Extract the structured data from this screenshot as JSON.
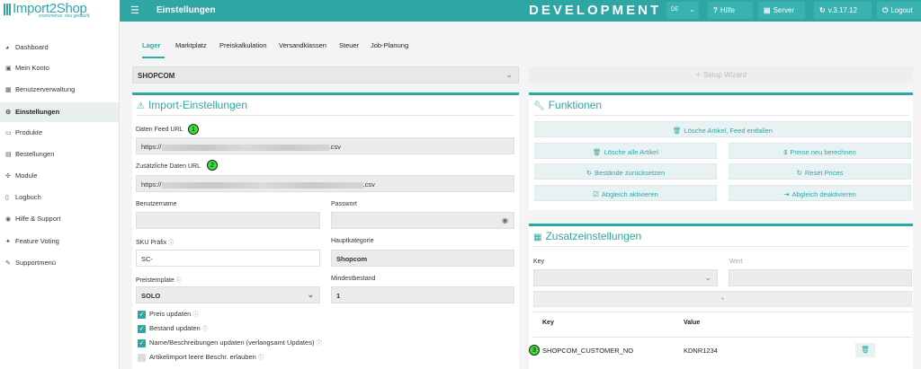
{
  "app": {
    "logo_text": "Import2Shop",
    "logo_tagline": "ecommerce. neu gedacht.",
    "page_title": "Einstellungen",
    "environment": "DEVELOPMENT",
    "language": "DE",
    "help_label": "Hilfe",
    "server_label": "Server",
    "version_label": "v.3.17.12",
    "logout_label": "Logout",
    "accent_color": "#2ea7a4"
  },
  "sidebar": {
    "items": [
      {
        "label": "Dashboard",
        "icon": "dashboard-icon"
      },
      {
        "label": "Mein Konto",
        "icon": "user-icon"
      },
      {
        "label": "Benutzerverwaltung",
        "icon": "users-icon"
      },
      {
        "label": "Einstellungen",
        "icon": "gear-icon",
        "active": true
      },
      {
        "label": "Produkte",
        "icon": "product-icon"
      },
      {
        "label": "Bestellungen",
        "icon": "cart-icon"
      },
      {
        "label": "Module",
        "icon": "module-icon"
      },
      {
        "label": "Logbuch",
        "icon": "log-icon"
      },
      {
        "label": "Hilfe & Support",
        "icon": "help-icon"
      },
      {
        "label": "Feature Voting",
        "icon": "thumbs-up-icon"
      },
      {
        "label": "Supportmenü",
        "icon": "wrench-icon"
      }
    ]
  },
  "tabs": [
    "Lager",
    "Marktplatz",
    "Preiskalkulation",
    "Versandklassen",
    "Steuer",
    "Job-Planung"
  ],
  "shop_select": {
    "value": "SHOPCOM"
  },
  "setup_wizard_label": "Setup Wizard",
  "import": {
    "title": "Import-Einstellungen",
    "feed_url_label": "Daten Feed URL",
    "feed_url_prefix": "https://",
    "feed_url_suffix": ".csv",
    "extra_url_label": "Zusätzliche Daten URL",
    "extra_url_prefix": "https://",
    "extra_url_suffix": ".csv",
    "username_label": "Benutzername",
    "username_value": "",
    "password_label": "Passwort",
    "password_value": "",
    "sku_label": "SKU Präfix",
    "sku_value": "SC-",
    "category_label": "Hauptkategorie",
    "category_value": "Shopcom",
    "price_template_label": "Preistemplate",
    "price_template_value": "SOLO",
    "min_stock_label": "Mindestbestand",
    "min_stock_value": "1",
    "checkboxes": [
      {
        "label": "Preis updaten",
        "checked": true
      },
      {
        "label": "Bestand updaten",
        "checked": true
      },
      {
        "label": "Name/Beschreibungen updaten (verlangsamt Updates)",
        "checked": true
      },
      {
        "label": "Artikelimport leere Beschr. erlauben",
        "checked": false
      }
    ]
  },
  "markers": [
    "1",
    "2",
    "3"
  ],
  "functions": {
    "title": "Funktionen",
    "delete_feed_label": "Lösche Artikel, Feed entfallen",
    "delete_all_label": "Lösche alle Artikel",
    "recalc_prices_label": "Preise neu berechnen",
    "reset_stock_label": "Bestände zurücksetzen",
    "reset_prices_label": "Reset Prices",
    "activate_sync_label": "Abgleich aktivieren",
    "deactivate_sync_label": "Abgleich deaktivieren"
  },
  "extra": {
    "title": "Zusatzeinstellungen",
    "key_label": "Key",
    "value_label": "Wert",
    "add_label": "+",
    "table_headers": {
      "key": "Key",
      "value": "Value"
    },
    "rows": [
      {
        "key": "SHOPCOM_CUSTOMER_NO",
        "value": "KDNR1234"
      }
    ]
  }
}
